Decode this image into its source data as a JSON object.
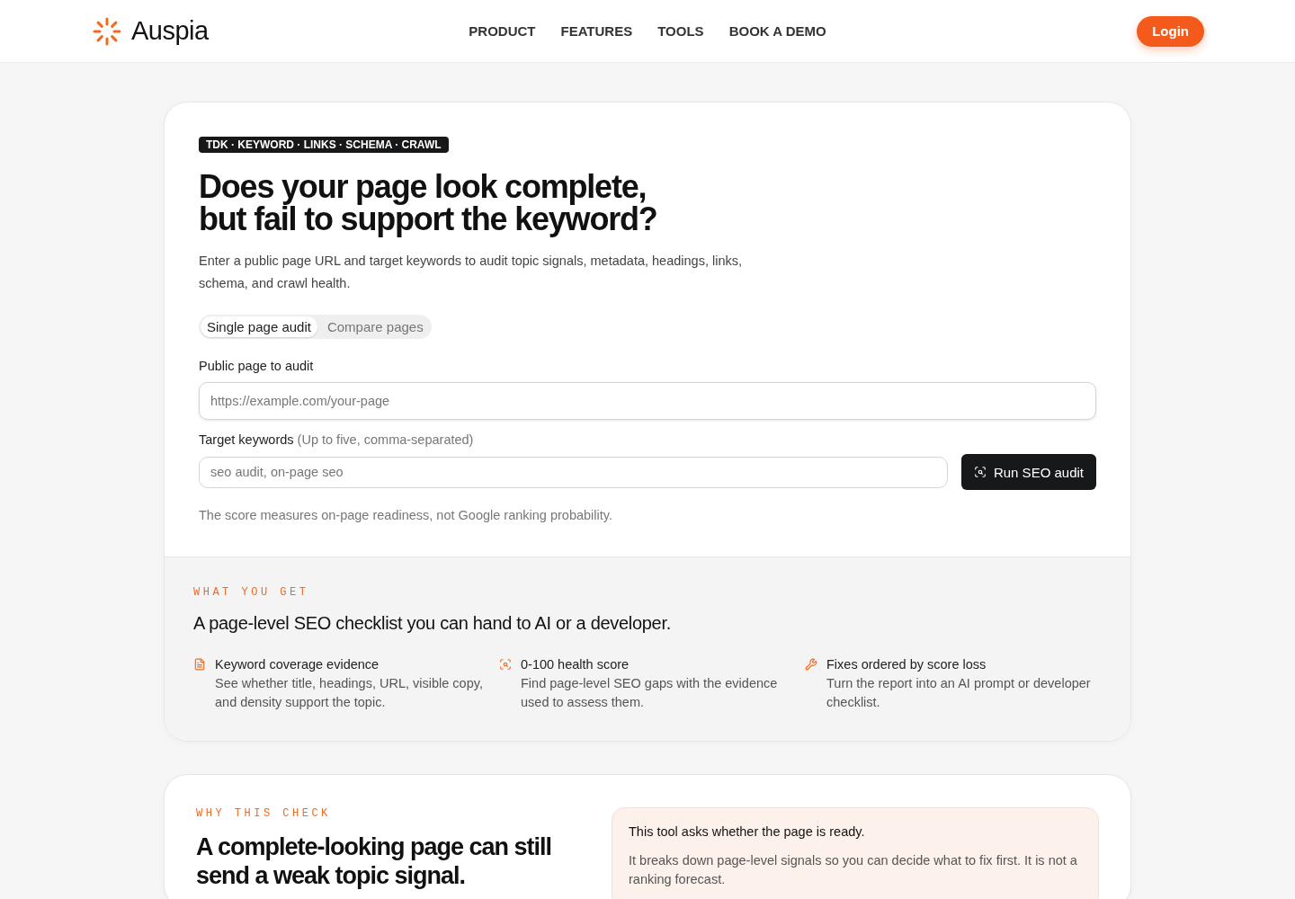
{
  "brand": {
    "name": "Auspia"
  },
  "nav": [
    "PRODUCT",
    "FEATURES",
    "TOOLS",
    "BOOK A DEMO"
  ],
  "login": "Login",
  "hero": {
    "badge": "TDK · KEYWORD · LINKS · SCHEMA · CRAWL",
    "title_lines": [
      "Does your page look complete,",
      "but fail to support the keyword?"
    ],
    "description": "Enter a public page URL and target keywords to audit topic signals, metadata, headings, links, schema, and crawl health.",
    "modes": [
      {
        "label": "Single page audit",
        "selected": true
      },
      {
        "label": "Compare pages",
        "selected": false
      }
    ],
    "url_field": {
      "label": "Public page to audit",
      "placeholder": "https://example.com/your-page"
    },
    "keywords_field": {
      "label": "Target keywords",
      "hint": "(Up to five, comma-separated)",
      "placeholder": "seo audit, on-page seo"
    },
    "submit": "Run SEO audit",
    "note": "The score measures on-page readiness, not Google ranking probability."
  },
  "what_you_get": {
    "eyebrow": "WHAT YOU GET",
    "title": "A page-level SEO checklist you can hand to AI or a developer.",
    "features": [
      {
        "kind": "document",
        "title": "Keyword coverage evidence",
        "text": "See whether title, headings, URL, visible copy, and density support the topic."
      },
      {
        "kind": "scan",
        "title": "0-100 health score",
        "text": "Find page-level SEO gaps with the evidence used to assess them."
      },
      {
        "kind": "wrench",
        "title": "Fixes ordered by score loss",
        "text": "Turn the report into an AI prompt or developer checklist."
      }
    ]
  },
  "why": {
    "eyebrow": "WHY THIS CHECK",
    "title": "A complete-looking page can still send a weak topic signal.",
    "callout": {
      "title": "This tool asks whether the page is ready.",
      "text": "It breaks down page-level signals so you can decide what to fix first. It is not a ranking forecast."
    }
  }
}
